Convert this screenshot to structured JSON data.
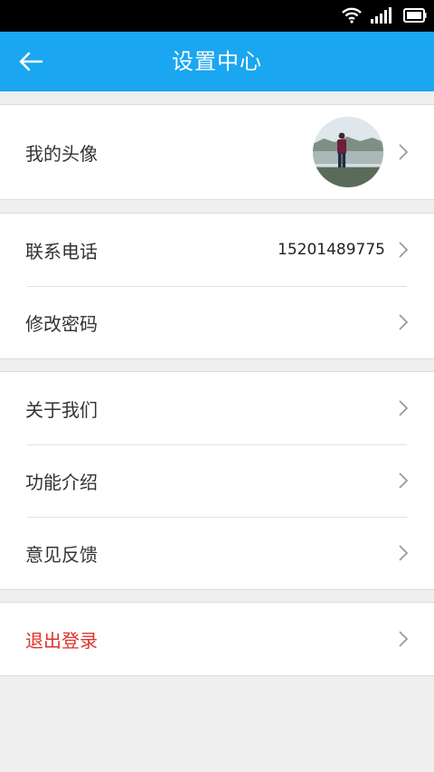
{
  "header": {
    "title": "设置中心"
  },
  "groups": [
    {
      "items": [
        {
          "label": "我的头像"
        }
      ]
    },
    {
      "items": [
        {
          "label": "联系电话",
          "value": "15201489775"
        },
        {
          "label": "修改密码"
        }
      ]
    },
    {
      "items": [
        {
          "label": "关于我们"
        },
        {
          "label": "功能介绍"
        },
        {
          "label": "意见反馈"
        }
      ]
    },
    {
      "items": [
        {
          "label": "退出登录"
        }
      ]
    }
  ],
  "colors": {
    "accent": "#1aa6f0",
    "logout": "#e0302c",
    "background": "#efefef"
  },
  "icons": {
    "back": "arrow-left-icon",
    "row": "chevron-right-icon"
  }
}
